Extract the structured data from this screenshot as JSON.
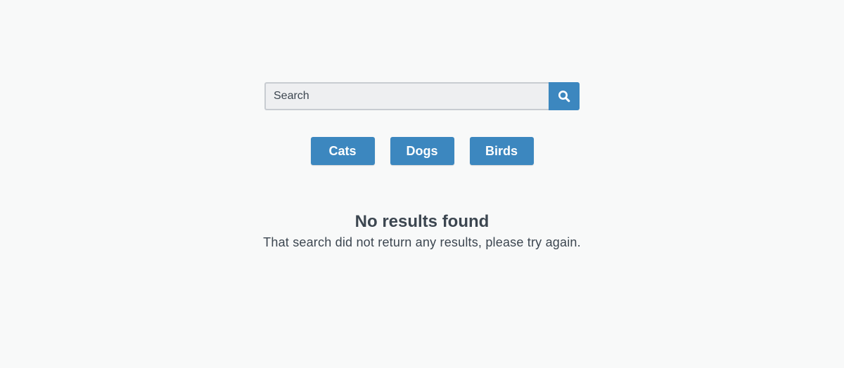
{
  "search": {
    "placeholder": "Search",
    "value": "",
    "button_icon": "search-icon"
  },
  "categories": [
    {
      "label": "Cats"
    },
    {
      "label": "Dogs"
    },
    {
      "label": "Birds"
    }
  ],
  "empty_state": {
    "title": "No results found",
    "message": "That search did not return any results, please try again."
  },
  "colors": {
    "accent": "#3c87bf",
    "text": "#3c4650",
    "background": "#f8f9f9",
    "input_background": "#eeeff1",
    "input_border": "#c8ccd1"
  }
}
